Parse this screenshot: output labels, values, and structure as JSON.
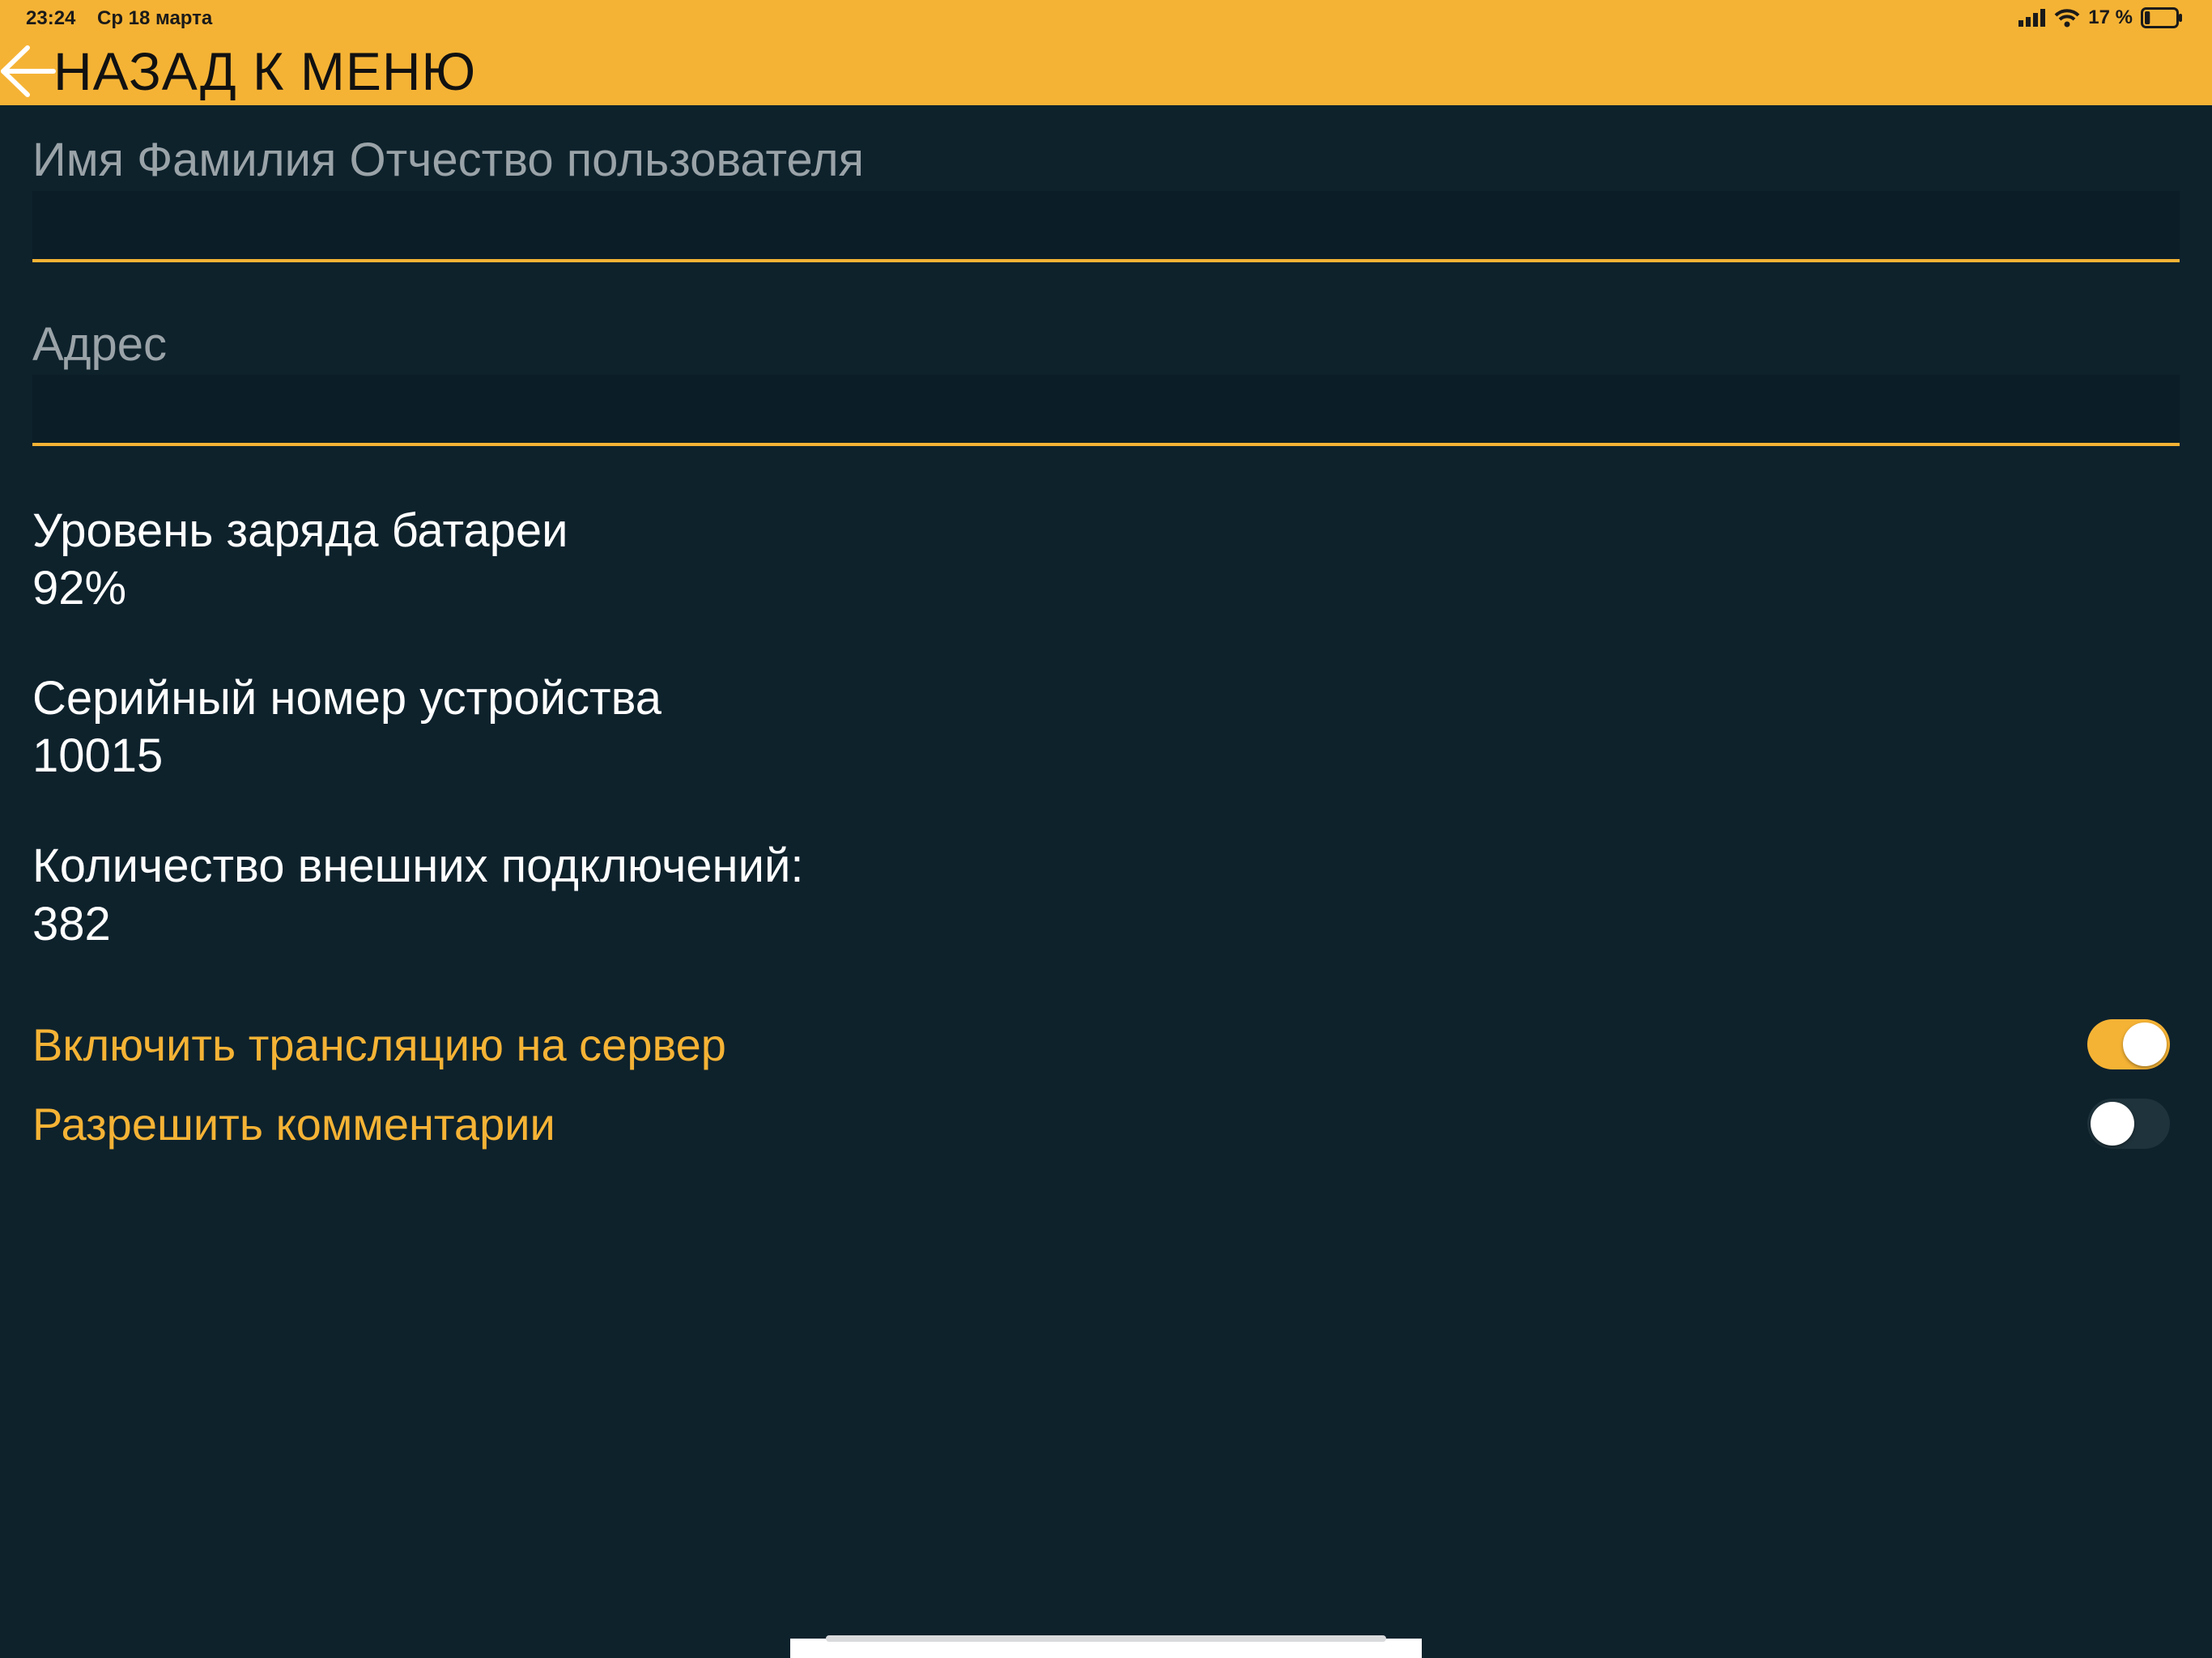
{
  "status_bar": {
    "time": "23:24",
    "date": "Ср 18 марта",
    "battery_percent": "17 %",
    "battery_level": 0.17,
    "icons": [
      "signal-icon",
      "wifi-icon",
      "battery-icon"
    ]
  },
  "header": {
    "back_label": "НАЗАД К МЕНЮ",
    "background_color": "#f5b335"
  },
  "form": {
    "name_label": "Имя Фамилия Отчество пользователя",
    "name_value": "",
    "address_label": "Адрес",
    "address_value": ""
  },
  "info": {
    "battery_label": "Уровень заряда батареи",
    "battery_value": "92%",
    "serial_label": "Серийный номер устройства",
    "serial_value": "10015",
    "connections_label": "Количество внешних подключений:",
    "connections_value": "382"
  },
  "toggles": [
    {
      "label": "Включить трансляцию на сервер",
      "on": true
    },
    {
      "label": "Разрешить комментарии",
      "on": false
    }
  ],
  "colors": {
    "accent": "#f5b335",
    "background": "#0e222c",
    "text": "#ffffff",
    "muted_text": "#9aa3a8"
  }
}
